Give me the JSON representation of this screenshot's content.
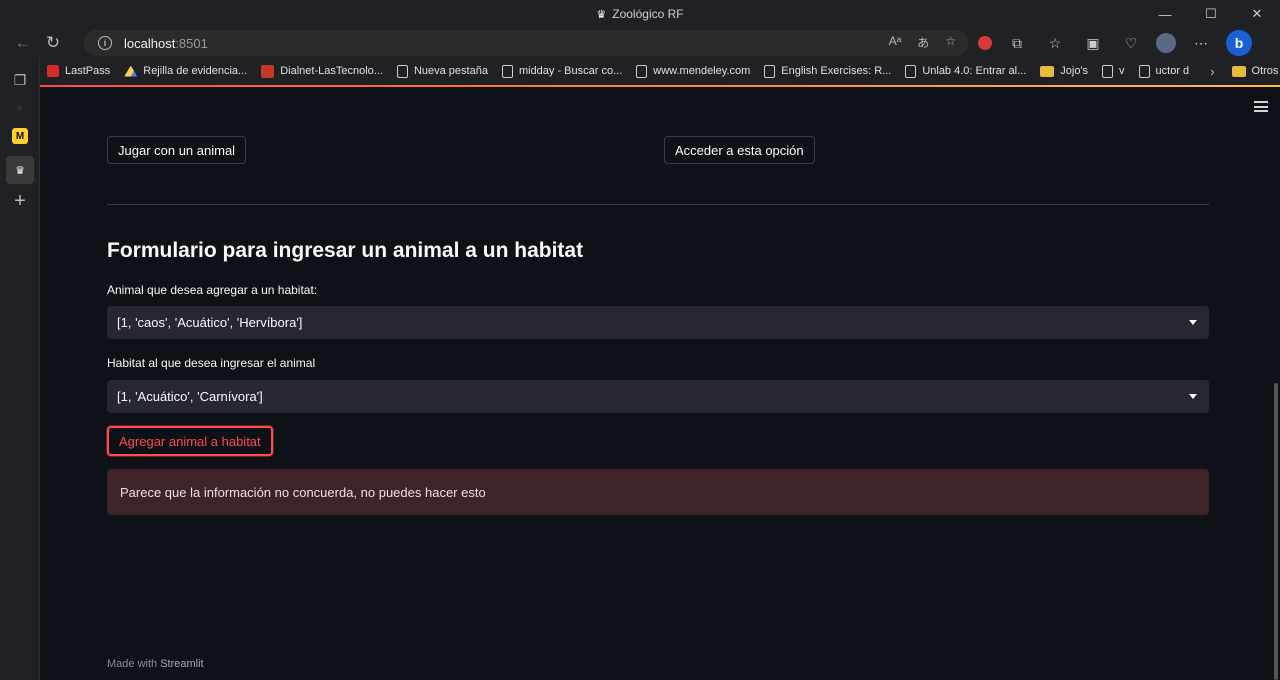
{
  "window": {
    "title": "Zoológico RF",
    "controls": [
      "—",
      "☐",
      "✕"
    ]
  },
  "address_bar": {
    "host": "localhost",
    "port": ":8501"
  },
  "bookmarks": [
    {
      "label": "LastPass",
      "icon": "lastpass-icon"
    },
    {
      "label": "Rejilla de evidencia...",
      "icon": "drive-icon"
    },
    {
      "label": "Dialnet-LasTecnolo...",
      "icon": "pdf-icon"
    },
    {
      "label": "Nueva pestaña",
      "icon": "page-icon"
    },
    {
      "label": "midday - Buscar co...",
      "icon": "page-icon"
    },
    {
      "label": "www.mendeley.com",
      "icon": "page-icon"
    },
    {
      "label": "English Exercises: R...",
      "icon": "page-icon"
    },
    {
      "label": "Unlab 4.0: Entrar al...",
      "icon": "page-icon"
    },
    {
      "label": "Jojo's",
      "icon": "folder-icon"
    },
    {
      "label": "v",
      "icon": "page-icon"
    },
    {
      "label": "uctor d",
      "icon": "page-icon"
    }
  ],
  "bookmarks_other": "Otros favoritos",
  "main": {
    "button_play": "Jugar con un animal",
    "button_access": "Acceder a esta opción",
    "form_title": "Formulario para ingresar un animal a un habitat",
    "animal_label": "Animal que desea agregar a un habitat:",
    "animal_value": "[1, 'caos', 'Acuático', 'Hervíbora']",
    "habitat_label": "Habitat al que desea ingresar el animal",
    "habitat_value": "[1, 'Acuático', 'Carnívora']",
    "submit_label": "Agregar animal a habitat",
    "error_message": "Parece que la información no concuerda, no puedes hacer esto"
  },
  "footer": {
    "prefix": "Made with",
    "brand": "Streamlit"
  },
  "colors": {
    "accent": "#ff4b4b",
    "background": "#0e1117",
    "error_bg": "#3e2327",
    "input_bg": "#262730"
  }
}
